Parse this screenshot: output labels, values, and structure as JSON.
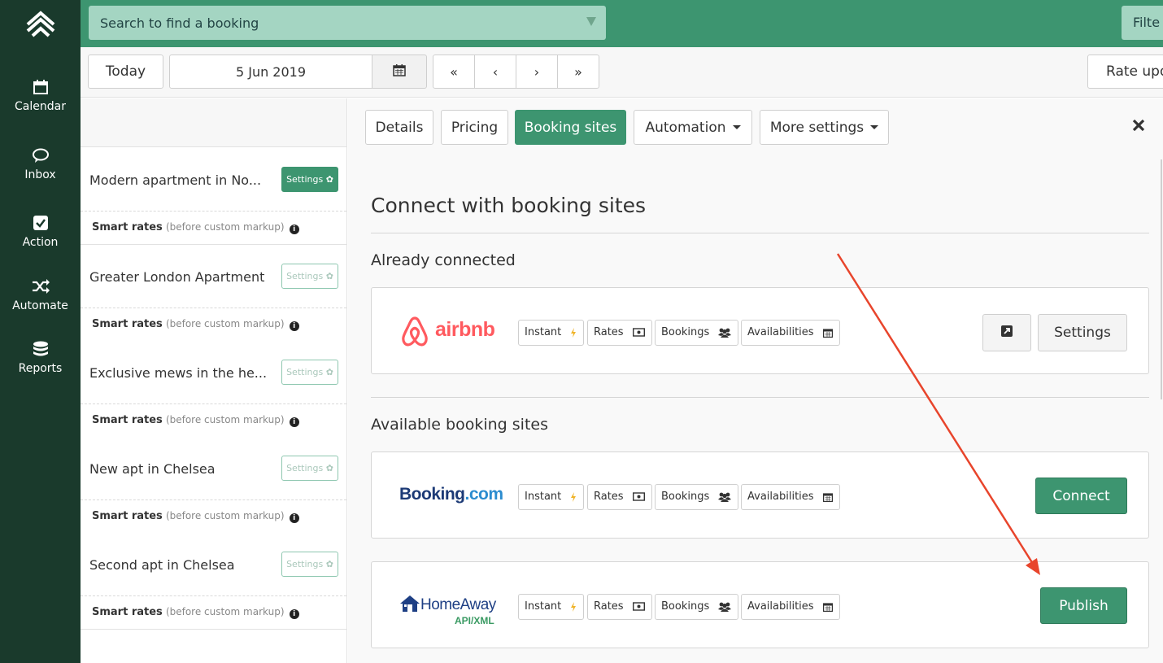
{
  "search": {
    "placeholder": "Search to find a booking"
  },
  "topbar": {
    "filter_label": "Filte"
  },
  "nav": {
    "items": [
      {
        "label": "Calendar",
        "icon": "calendar-icon"
      },
      {
        "label": "Inbox",
        "icon": "chat-icon"
      },
      {
        "label": "Action",
        "icon": "check-square-icon"
      },
      {
        "label": "Automate",
        "icon": "shuffle-icon"
      },
      {
        "label": "Reports",
        "icon": "database-icon"
      }
    ]
  },
  "datebar": {
    "today_label": "Today",
    "date_value": "5 Jun 2019",
    "first_label": "«",
    "prev_label": "‹",
    "next_label": "›",
    "last_label": "»",
    "rate_label": "Rate upd"
  },
  "listings": [
    {
      "name": "Modern apartment in No...",
      "settings_label": "Settings ✿",
      "active": true
    },
    {
      "name": "Greater London Apartment",
      "settings_label": "Settings ✿",
      "active": false
    },
    {
      "name": "Exclusive mews in the he...",
      "settings_label": "Settings ✿",
      "active": false
    },
    {
      "name": "New apt in Chelsea",
      "settings_label": "Settings ✿",
      "active": false
    },
    {
      "name": "Second apt in Chelsea",
      "settings_label": "Settings ✿",
      "active": false
    }
  ],
  "smart_rates": {
    "label": "Smart rates",
    "note": "(before custom markup)"
  },
  "tabs": [
    {
      "label": "Details"
    },
    {
      "label": "Pricing"
    },
    {
      "label": "Booking sites"
    },
    {
      "label": "Automation"
    },
    {
      "label": "More settings"
    }
  ],
  "panel": {
    "title": "Connect with booking sites",
    "connected_heading": "Already connected",
    "available_heading": "Available booking sites"
  },
  "chips": {
    "instant": "Instant",
    "rates": "Rates",
    "bookings": "Bookings",
    "availabilities": "Availabilities"
  },
  "sites": {
    "airbnb": {
      "logo_text": "airbnb",
      "settings_label": "Settings"
    },
    "booking": {
      "logo_text": "Booking",
      "logo_suffix": ".com",
      "action_label": "Connect"
    },
    "homeaway": {
      "logo_text": "HomeAway",
      "logo_sub": "API/XML",
      "action_label": "Publish"
    }
  },
  "colors": {
    "sidebar": "#1a3a2c",
    "topbar": "#3d9570",
    "accent": "#3d9570",
    "airbnb": "#ff5a5f",
    "arrow": "#e8452c"
  }
}
